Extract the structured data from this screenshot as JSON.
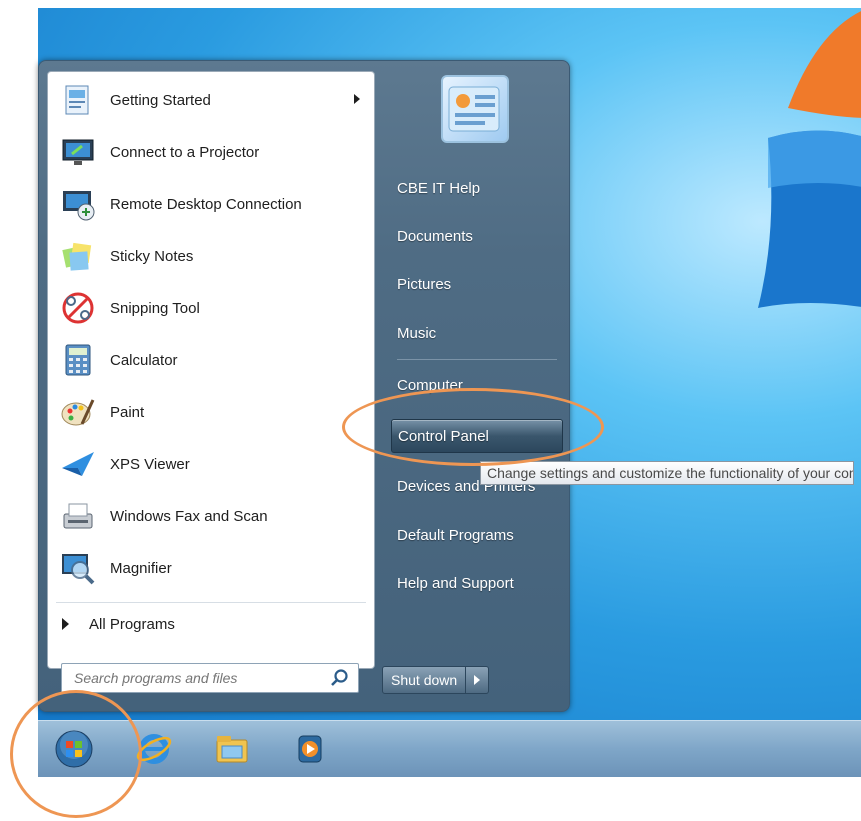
{
  "programs": [
    {
      "label": "Getting Started",
      "icon": "getting-started-icon",
      "has_submenu": true
    },
    {
      "label": "Connect to a Projector",
      "icon": "projector-icon"
    },
    {
      "label": "Remote Desktop Connection",
      "icon": "remote-desktop-icon"
    },
    {
      "label": "Sticky Notes",
      "icon": "sticky-notes-icon"
    },
    {
      "label": "Snipping Tool",
      "icon": "snipping-tool-icon"
    },
    {
      "label": "Calculator",
      "icon": "calculator-icon"
    },
    {
      "label": "Paint",
      "icon": "paint-icon"
    },
    {
      "label": "XPS Viewer",
      "icon": "xps-viewer-icon"
    },
    {
      "label": "Windows Fax and Scan",
      "icon": "fax-scan-icon"
    },
    {
      "label": "Magnifier",
      "icon": "magnifier-icon"
    }
  ],
  "all_programs_label": "All Programs",
  "search": {
    "placeholder": "Search programs and files"
  },
  "right_items": [
    {
      "label": "CBE IT Help"
    },
    {
      "label": "Documents"
    },
    {
      "label": "Pictures"
    },
    {
      "label": "Music"
    },
    {
      "label": "Computer"
    },
    {
      "label": "Control Panel",
      "highlighted": true
    },
    {
      "label": "Devices and Printers"
    },
    {
      "label": "Default Programs"
    },
    {
      "label": "Help and Support"
    }
  ],
  "shutdown_label": "Shut down",
  "tooltip": "Change settings and customize the functionality of your computer.",
  "taskbar": [
    "start-orb-icon",
    "internet-explorer-icon",
    "file-explorer-icon",
    "media-player-icon"
  ],
  "colors": {
    "highlight_ring": "#ee9653",
    "menu_dark": "#44627b",
    "desktop_blue": "#2a9be0"
  }
}
